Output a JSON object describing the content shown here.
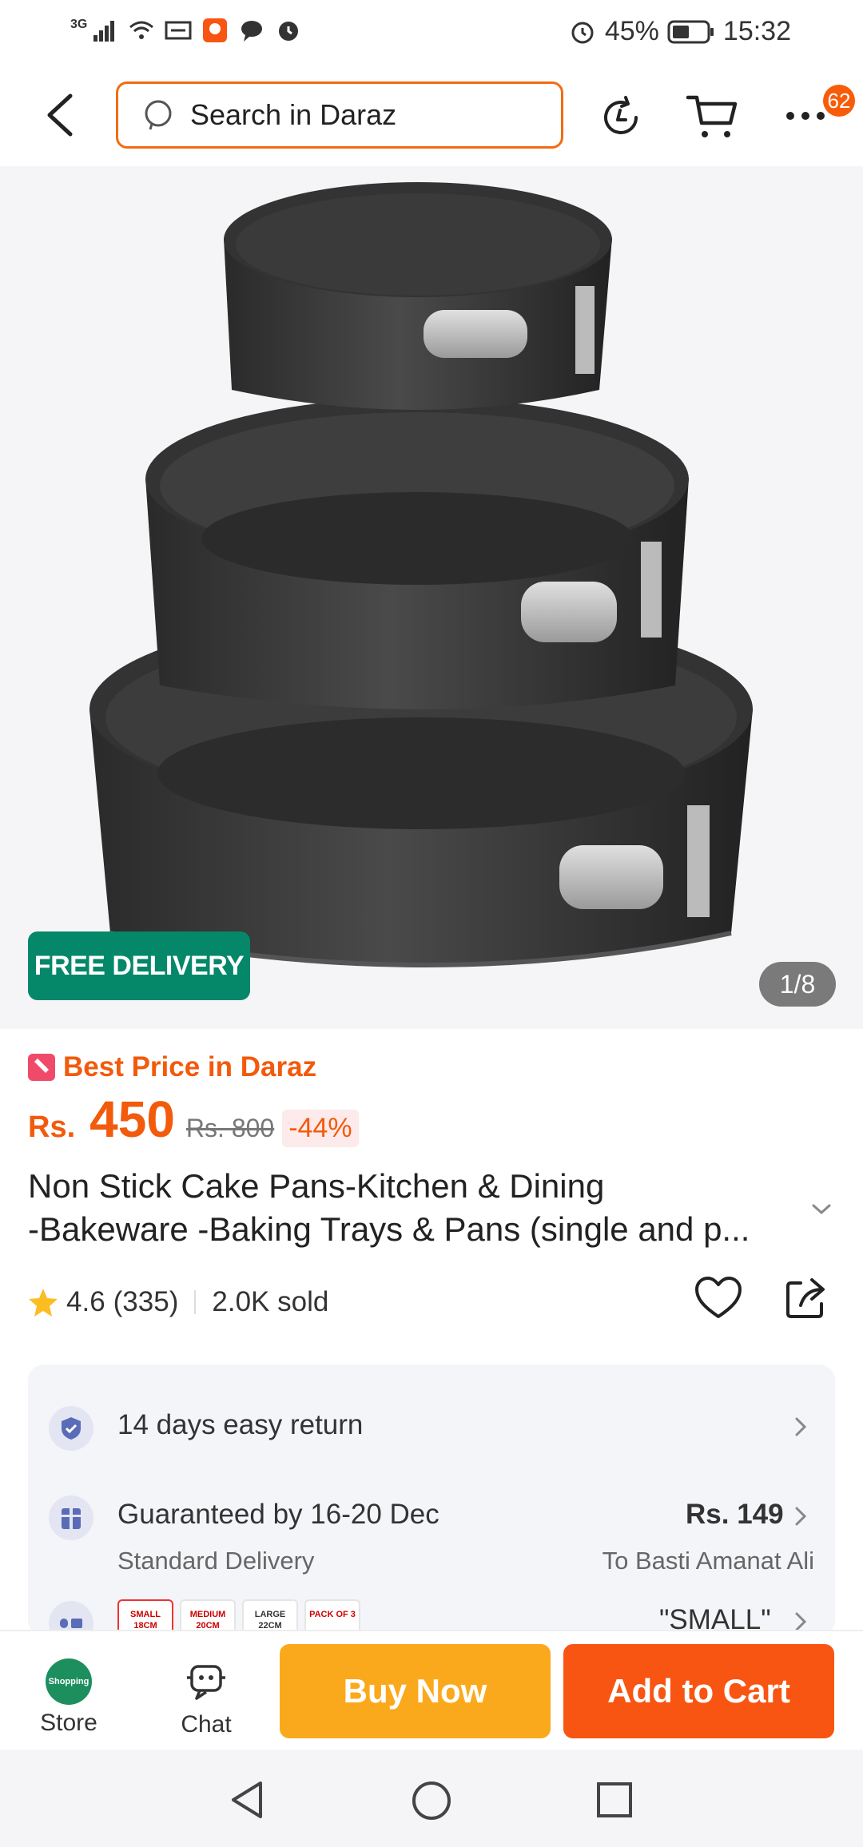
{
  "status_bar": {
    "network": "3G",
    "battery": "45%",
    "time": "15:32"
  },
  "header": {
    "search_placeholder": "Search in Daraz",
    "more_badge": "62"
  },
  "gallery": {
    "free_delivery_label": "FREE DELIVERY",
    "counter": "1/8"
  },
  "price": {
    "tag": "Best Price in Daraz",
    "currency": "Rs.",
    "current": "450",
    "original": "Rs. 800",
    "discount": "-44%"
  },
  "product": {
    "title_line1": "Non Stick Cake Pans-Kitchen & Dining",
    "title_line2": "-Bakeware -Baking Trays & Pans (single and p..."
  },
  "rating": {
    "score": "4.6",
    "count": "(335)",
    "sold": "2.0K sold"
  },
  "services": {
    "return_text": "14 days easy return",
    "delivery_text": "Guaranteed by 16-20 Dec",
    "delivery_price": "Rs. 149",
    "delivery_type": "Standard Delivery",
    "delivery_to": "To Basti Amanat Ali",
    "variant_selected": "\"SMALL\"",
    "variants": [
      "SMALL 18CM",
      "MEDIUM 20CM",
      "LARGE 22CM",
      "PACK OF 3"
    ]
  },
  "bottom_bar": {
    "store_label": "Store",
    "store_logo_text": "Shopping",
    "chat_label": "Chat",
    "buy_now": "Buy Now",
    "add_to_cart": "Add to Cart"
  },
  "colors": {
    "brand_orange": "#f85512",
    "buy_now_yellow": "#fba91c",
    "free_delivery_green": "#05876a"
  }
}
